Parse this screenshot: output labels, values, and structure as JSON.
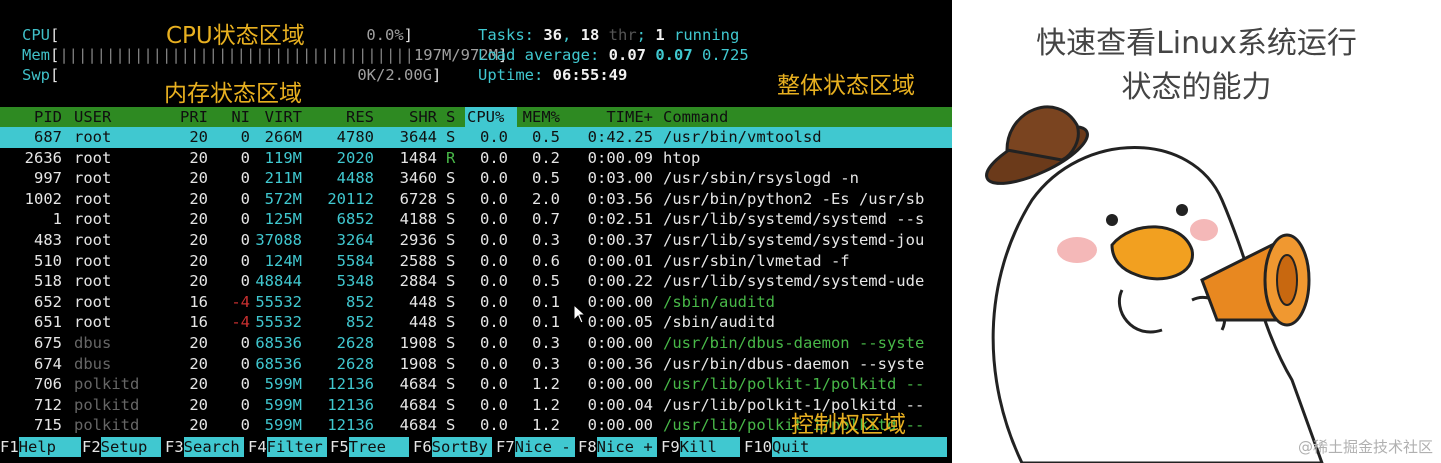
{
  "meters": {
    "cpu": {
      "label": "CPU",
      "value": "0.0%"
    },
    "mem": {
      "label": "Mem",
      "bar": "||||||||||||||||||||||||||||||||||||||",
      "value": "197M/972M"
    },
    "swp": {
      "label": "Swp",
      "value": "0K/2.00G"
    }
  },
  "summary": {
    "tasks_label": "Tasks: ",
    "tasks": "36",
    "comma": ", ",
    "threads": "18",
    "thr_label": " thr",
    "semi": "; ",
    "running": "1",
    "running_label": " running",
    "load_label": "Load average: ",
    "load1": "0.07",
    "load5": "0.07",
    "load15": "0.725",
    "uptime_label": "Uptime: ",
    "uptime": "06:55:49"
  },
  "annotations": {
    "cpu_area": "CPU状态区域",
    "mem_area": "内存状态区域",
    "overall_area": "整体状态区域",
    "control_area": "控制权区域"
  },
  "headers": [
    "PID",
    "USER",
    "PRI",
    "NI",
    "VIRT",
    "RES",
    "SHR",
    "S",
    "CPU%",
    "MEM%",
    "TIME+",
    "Command"
  ],
  "processes": [
    {
      "pid": "687",
      "user": "root",
      "pri": "20",
      "ni": "0",
      "virt": "266M",
      "res": "4780",
      "shr": "3644",
      "s": "S",
      "cpu": "0.0",
      "mem": "0.5",
      "time": "0:42.25",
      "cmd": "/usr/bin/vmtoolsd"
    },
    {
      "pid": "2636",
      "user": "root",
      "pri": "20",
      "ni": "0",
      "virt": "119M",
      "res": "2020",
      "shr": "1484",
      "s": "R",
      "cpu": "0.0",
      "mem": "0.2",
      "time": "0:00.09",
      "cmd": "htop"
    },
    {
      "pid": "997",
      "user": "root",
      "pri": "20",
      "ni": "0",
      "virt": "211M",
      "res": "4488",
      "shr": "3460",
      "s": "S",
      "cpu": "0.0",
      "mem": "0.5",
      "time": "0:03.00",
      "cmd": "/usr/sbin/rsyslogd -n"
    },
    {
      "pid": "1002",
      "user": "root",
      "pri": "20",
      "ni": "0",
      "virt": "572M",
      "res": "20112",
      "shr": "6728",
      "s": "S",
      "cpu": "0.0",
      "mem": "2.0",
      "time": "0:03.56",
      "cmd": "/usr/bin/python2 -Es /usr/sb"
    },
    {
      "pid": "1",
      "user": "root",
      "pri": "20",
      "ni": "0",
      "virt": "125M",
      "res": "6852",
      "shr": "4188",
      "s": "S",
      "cpu": "0.0",
      "mem": "0.7",
      "time": "0:02.51",
      "cmd": "/usr/lib/systemd/systemd --s"
    },
    {
      "pid": "483",
      "user": "root",
      "pri": "20",
      "ni": "0",
      "virt": "37088",
      "res": "3264",
      "shr": "2936",
      "s": "S",
      "cpu": "0.0",
      "mem": "0.3",
      "time": "0:00.37",
      "cmd": "/usr/lib/systemd/systemd-jou"
    },
    {
      "pid": "510",
      "user": "root",
      "pri": "20",
      "ni": "0",
      "virt": "124M",
      "res": "5584",
      "shr": "2588",
      "s": "S",
      "cpu": "0.0",
      "mem": "0.6",
      "time": "0:00.01",
      "cmd": "/usr/sbin/lvmetad -f"
    },
    {
      "pid": "518",
      "user": "root",
      "pri": "20",
      "ni": "0",
      "virt": "48844",
      "res": "5348",
      "shr": "2884",
      "s": "S",
      "cpu": "0.0",
      "mem": "0.5",
      "time": "0:00.22",
      "cmd": "/usr/lib/systemd/systemd-ude"
    },
    {
      "pid": "652",
      "user": "root",
      "pri": "16",
      "ni": "-4",
      "virt": "55532",
      "res": "852",
      "shr": "448",
      "s": "S",
      "cpu": "0.0",
      "mem": "0.1",
      "time": "0:00.00",
      "cmd": "/sbin/auditd"
    },
    {
      "pid": "651",
      "user": "root",
      "pri": "16",
      "ni": "-4",
      "virt": "55532",
      "res": "852",
      "shr": "448",
      "s": "S",
      "cpu": "0.0",
      "mem": "0.1",
      "time": "0:00.05",
      "cmd": "/sbin/auditd"
    },
    {
      "pid": "675",
      "user": "dbus",
      "pri": "20",
      "ni": "0",
      "virt": "68536",
      "res": "2628",
      "shr": "1908",
      "s": "S",
      "cpu": "0.0",
      "mem": "0.3",
      "time": "0:00.00",
      "cmd": "/usr/bin/dbus-daemon --syste"
    },
    {
      "pid": "674",
      "user": "dbus",
      "pri": "20",
      "ni": "0",
      "virt": "68536",
      "res": "2628",
      "shr": "1908",
      "s": "S",
      "cpu": "0.0",
      "mem": "0.3",
      "time": "0:00.36",
      "cmd": "/usr/bin/dbus-daemon --syste"
    },
    {
      "pid": "706",
      "user": "polkitd",
      "pri": "20",
      "ni": "0",
      "virt": "599M",
      "res": "12136",
      "shr": "4684",
      "s": "S",
      "cpu": "0.0",
      "mem": "1.2",
      "time": "0:00.00",
      "cmd": "/usr/lib/polkit-1/polkitd --"
    },
    {
      "pid": "712",
      "user": "polkitd",
      "pri": "20",
      "ni": "0",
      "virt": "599M",
      "res": "12136",
      "shr": "4684",
      "s": "S",
      "cpu": "0.0",
      "mem": "1.2",
      "time": "0:00.04",
      "cmd": "/usr/lib/polkit-1/polkitd --"
    },
    {
      "pid": "715",
      "user": "polkitd",
      "pri": "20",
      "ni": "0",
      "virt": "599M",
      "res": "12136",
      "shr": "4684",
      "s": "S",
      "cpu": "0.0",
      "mem": "1.2",
      "time": "0:00.00",
      "cmd": "/usr/lib/polkit-1/polkitd --"
    }
  ],
  "fkeys": [
    {
      "key": "F1",
      "action": "Help"
    },
    {
      "key": "F2",
      "action": "Setup"
    },
    {
      "key": "F3",
      "action": "Search"
    },
    {
      "key": "F4",
      "action": "Filter"
    },
    {
      "key": "F5",
      "action": "Tree"
    },
    {
      "key": "F6",
      "action": "SortBy"
    },
    {
      "key": "F7",
      "action": "Nice -"
    },
    {
      "key": "F8",
      "action": "Nice +"
    },
    {
      "key": "F9",
      "action": "Kill"
    },
    {
      "key": "F10",
      "action": "Quit"
    }
  ],
  "right_panel": {
    "caption_line1": "快速查看Linux系统运行",
    "caption_line2": "状态的能力",
    "watermark": "@稀土掘金技术社区"
  }
}
